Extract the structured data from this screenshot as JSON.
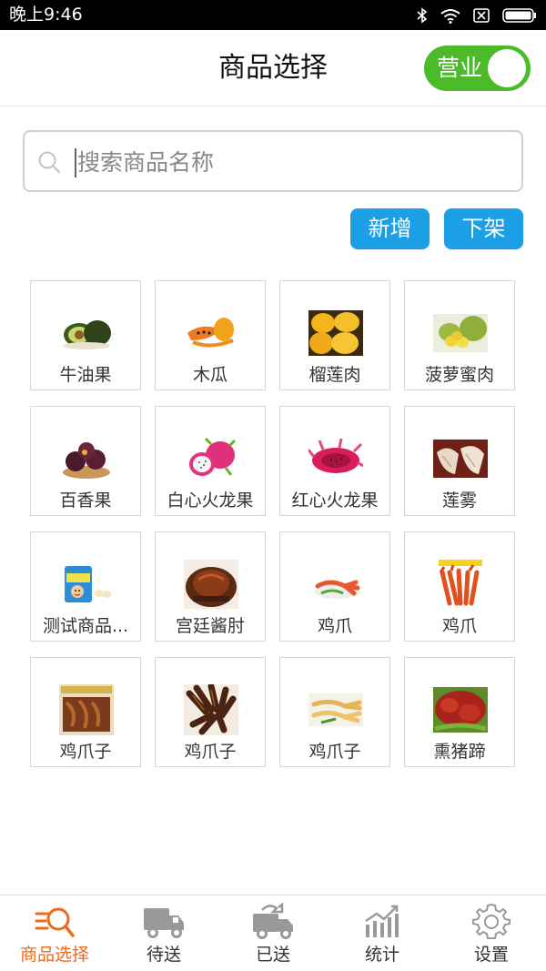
{
  "status_bar": {
    "time": "晚上9:46"
  },
  "header": {
    "title": "商品选择",
    "toggle_label": "营业",
    "toggle_on": true
  },
  "search": {
    "placeholder": "搜索商品名称",
    "value": ""
  },
  "actions": {
    "add_label": "新增",
    "remove_label": "下架"
  },
  "products": [
    {
      "name": "牛油果",
      "icon": "avocado-image"
    },
    {
      "name": "木瓜",
      "icon": "papaya-image"
    },
    {
      "name": "榴莲肉",
      "icon": "durian-image"
    },
    {
      "name": "菠萝蜜肉",
      "icon": "jackfruit-image"
    },
    {
      "name": "百香果",
      "icon": "passion-fruit-image"
    },
    {
      "name": "白心火龙果",
      "icon": "white-dragon-fruit-image"
    },
    {
      "name": "红心火龙果",
      "icon": "red-dragon-fruit-image"
    },
    {
      "name": "莲雾",
      "icon": "wax-apple-image"
    },
    {
      "name": "测试商品...",
      "icon": "candy-bag-image"
    },
    {
      "name": "宫廷酱肘",
      "icon": "braised-pork-image"
    },
    {
      "name": "鸡爪",
      "icon": "chicken-feet-image"
    },
    {
      "name": "鸡爪",
      "icon": "chicken-feet-image"
    },
    {
      "name": "鸡爪子",
      "icon": "chicken-feet-box-image"
    },
    {
      "name": "鸡爪子",
      "icon": "chicken-feet-dark-image"
    },
    {
      "name": "鸡爪子",
      "icon": "chicken-feet-plate-image"
    },
    {
      "name": "熏猪蹄",
      "icon": "smoked-trotter-image"
    }
  ],
  "tabs": [
    {
      "label": "商品选择",
      "icon": "product-search-icon",
      "active": true
    },
    {
      "label": "待送",
      "icon": "truck-icon",
      "active": false
    },
    {
      "label": "已送",
      "icon": "truck-delivered-icon",
      "active": false
    },
    {
      "label": "统计",
      "icon": "chart-icon",
      "active": false
    },
    {
      "label": "设置",
      "icon": "gear-icon",
      "active": false
    }
  ],
  "colors": {
    "accent_blue": "#1ba0e8",
    "toggle_green": "#4cbb2a",
    "active_tab": "#f06a1c"
  }
}
